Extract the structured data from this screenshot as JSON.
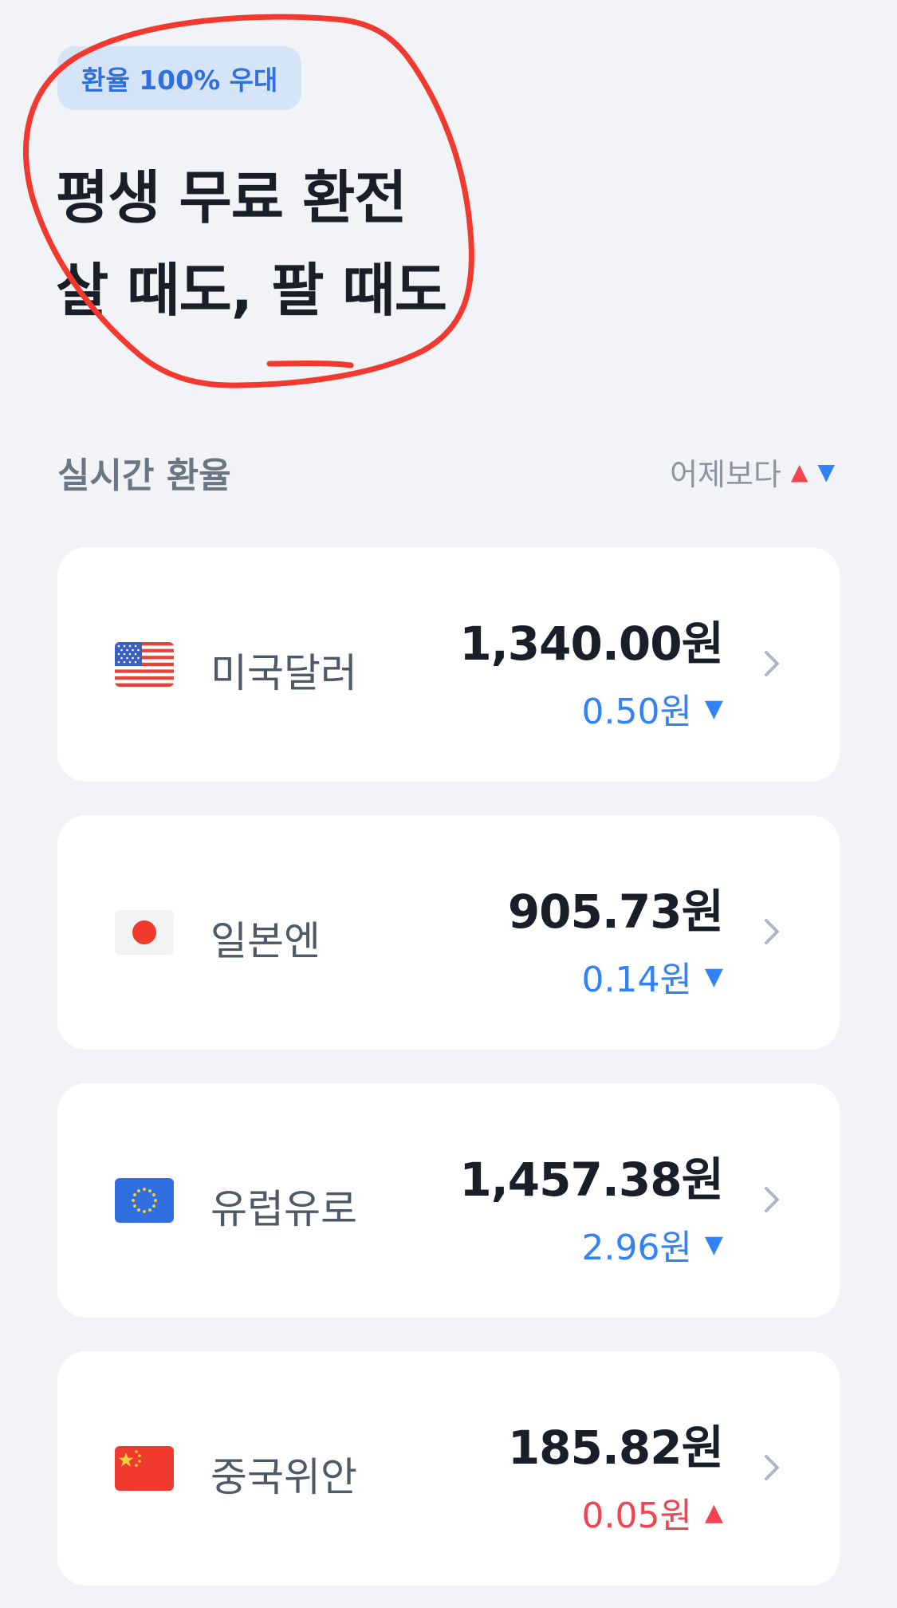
{
  "badge": "환율 100% 우대",
  "headline": {
    "line1": "평생 무료 환전",
    "line2": "살 때도, 팔 때도"
  },
  "section": {
    "title": "실시간 환율",
    "compare_label": "어제보다",
    "up_symbol": "▲",
    "down_symbol": "▼"
  },
  "currencies": [
    {
      "name": "미국달러",
      "rate": "1,340.00원",
      "change": "0.50원",
      "direction": "down",
      "arrow": "▼",
      "flag": "us-flag-icon"
    },
    {
      "name": "일본엔",
      "rate": "905.73원",
      "change": "0.14원",
      "direction": "down",
      "arrow": "▼",
      "flag": "jp-flag-icon"
    },
    {
      "name": "유럽유로",
      "rate": "1,457.38원",
      "change": "2.96원",
      "direction": "down",
      "arrow": "▼",
      "flag": "eu-flag-icon"
    },
    {
      "name": "중국위안",
      "rate": "185.82원",
      "change": "0.05원",
      "direction": "up",
      "arrow": "▲",
      "flag": "cn-flag-icon"
    }
  ],
  "colors": {
    "up": "#f04452",
    "down": "#3182f6",
    "badge_bg": "#d6e4f7",
    "badge_text": "#2f6fde",
    "annotation": "#f2392f"
  }
}
